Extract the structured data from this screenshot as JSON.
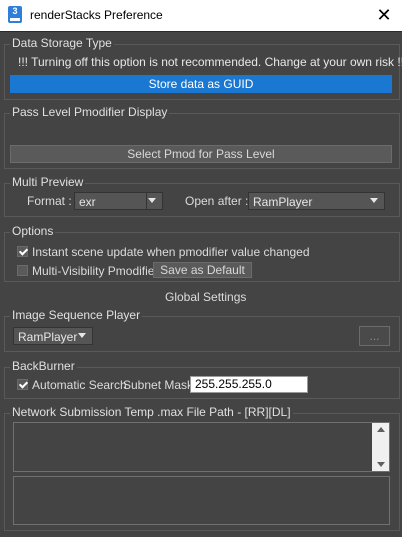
{
  "window": {
    "title": "renderStacks Preference",
    "icon_text": "3",
    "close_glyph": "✕"
  },
  "data_storage": {
    "label": "Data Storage Type",
    "warning": "!!! Turning off this option is not recommended. Change at your own risk !!!",
    "button": "Store data as GUID"
  },
  "pass_level": {
    "label": "Pass Level Pmodifier Display",
    "button": "Select Pmod for Pass Level"
  },
  "multi_preview": {
    "label": "Multi Preview",
    "format_label": "Format :",
    "format_value": "exr",
    "open_after_label": "Open after :",
    "open_after_value": "RamPlayer"
  },
  "options": {
    "label": "Options",
    "instant_update_label": "Instant scene update when pmodifier value changed",
    "instant_update_checked": true,
    "multi_visibility_label": "Multi-Visibility Pmodifier",
    "multi_visibility_checked": false,
    "save_default_button": "Save as Default"
  },
  "global_settings": {
    "label": "Global Settings"
  },
  "image_sequence": {
    "label": "Image Sequence Player",
    "player_value": "RamPlayer",
    "browse_button": "..."
  },
  "backburner": {
    "label": "BackBurner",
    "auto_search_label": "Automatic Search",
    "auto_search_checked": true,
    "subnet_label": "Subnet Mask",
    "subnet_value": "255.255.255.0"
  },
  "network": {
    "label": "Network Submission Temp .max File Path - [RR][DL]"
  }
}
